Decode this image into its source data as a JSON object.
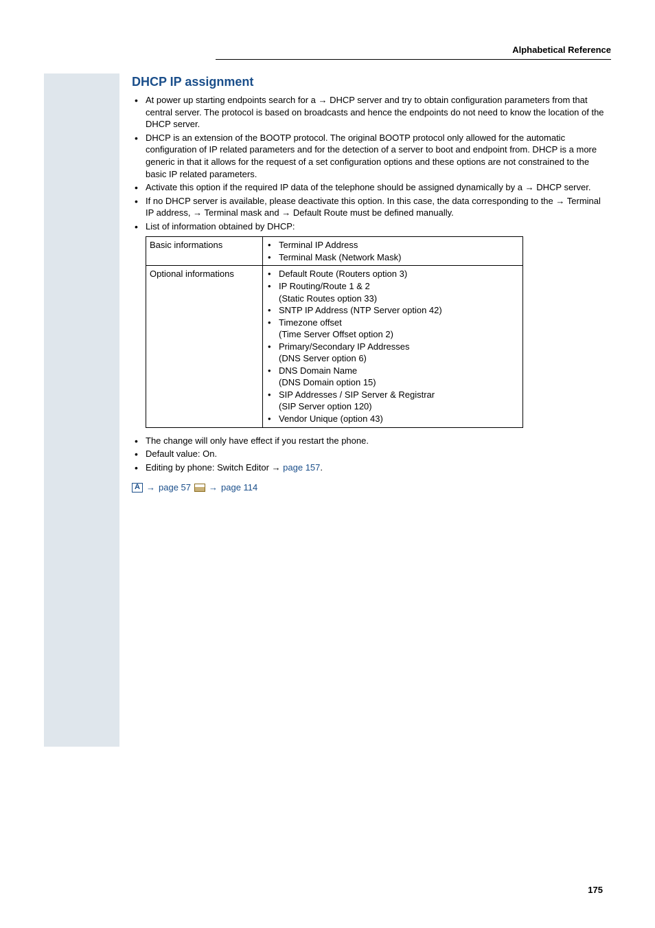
{
  "header": "Alphabetical Reference",
  "section_title": "DHCP IP assignment",
  "bullets_top": [
    {
      "parts": [
        {
          "t": "At power up starting endpoints search for a "
        },
        {
          "t": "→",
          "arrow": true
        },
        {
          "t": " DHCP server and try to obtain configuration parameters from that central server. The protocol is based on broadcasts and hence the endpoints do not need to know the location of the DHCP server."
        }
      ]
    },
    {
      "parts": [
        {
          "t": "DHCP is an extension of the BOOTP protocol. The original BOOTP protocol only allowed for the automatic configuration of IP related  parameters and for the detection of a server to boot and endpoint from. DHCP is a more generic in that it allows for the request of a set configuration options and these options are not constrained to the basic IP related parameters."
        }
      ]
    },
    {
      "parts": [
        {
          "t": "Activate this option if the required IP data of the telephone should be assigned dynamically by a "
        },
        {
          "t": "→",
          "arrow": true
        },
        {
          "t": " DHCP server."
        }
      ]
    },
    {
      "parts": [
        {
          "t": "If no DHCP server is available, please deactivate this option. In this case, the data corresponding to the "
        },
        {
          "t": "→",
          "arrow": true
        },
        {
          "t": " Terminal IP address, "
        },
        {
          "t": "→",
          "arrow": true
        },
        {
          "t": " Terminal mask and "
        },
        {
          "t": "→",
          "arrow": true
        },
        {
          "t": " Default Route must be defined manually."
        }
      ]
    },
    {
      "parts": [
        {
          "t": "List of information obtained by DHCP:"
        }
      ]
    }
  ],
  "table": {
    "rows": [
      {
        "label": "Basic informations",
        "items": [
          {
            "text": "Terminal IP Address",
            "bullet": true
          },
          {
            "text": "Terminal Mask (Network Mask)",
            "bullet": true
          }
        ]
      },
      {
        "label": "Optional informations",
        "items": [
          {
            "text": "Default Route (Routers option 3)",
            "bullet": true
          },
          {
            "text": "IP Routing/Route 1 & 2",
            "bullet": true
          },
          {
            "text": "(Static Routes option 33)",
            "bullet": false
          },
          {
            "text": "SNTP IP Address (NTP Server option 42)",
            "bullet": true
          },
          {
            "text": "Timezone offset",
            "bullet": true
          },
          {
            "text": "(Time Server Offset option 2)",
            "bullet": false
          },
          {
            "text": "Primary/Secondary IP Addresses",
            "bullet": true
          },
          {
            "text": "(DNS Server option 6)",
            "bullet": false
          },
          {
            "text": "DNS Domain Name",
            "bullet": true
          },
          {
            "text": "(DNS Domain option 15)",
            "bullet": false
          },
          {
            "text": "SIP Addresses / SIP Server & Registrar",
            "bullet": true
          },
          {
            "text": "(SIP Server option 120)",
            "bullet": false
          },
          {
            "text": "Vendor Unique (option 43)",
            "bullet": true
          }
        ]
      }
    ]
  },
  "bullets_bottom": [
    {
      "parts": [
        {
          "t": "The change will only have effect if you restart the phone."
        }
      ]
    },
    {
      "parts": [
        {
          "t": "Default value: On."
        }
      ]
    },
    {
      "parts": [
        {
          "t": "Editing by phone: Switch Editor "
        },
        {
          "t": "→",
          "arrow": true
        },
        {
          "t": " page 157",
          "link": true
        },
        {
          "t": "."
        }
      ]
    }
  ],
  "ref": {
    "icon_a": "A",
    "arrow1": "→",
    "page1": "page 57",
    "arrow2": "→",
    "page2": "page 114"
  },
  "page_number": "175"
}
